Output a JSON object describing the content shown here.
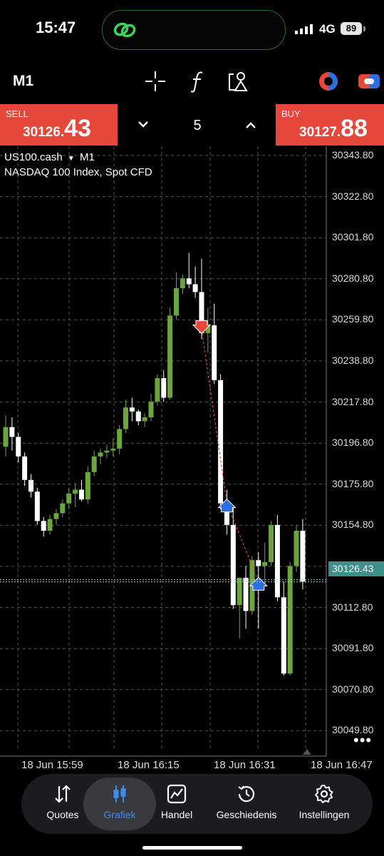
{
  "status_bar": {
    "time": "15:47",
    "network": "4G",
    "battery": "89"
  },
  "toolbar": {
    "timeframe": "M1"
  },
  "trade": {
    "sell_label": "SELL",
    "sell_price_main": "30126.",
    "sell_price_big": "43",
    "buy_label": "BUY",
    "buy_price_main": "30127.",
    "buy_price_big": "88",
    "lot": "5"
  },
  "chart": {
    "symbol": "US100.cash",
    "timeframe": "M1",
    "description": "NASDAQ 100 Index, Spot CFD",
    "price_labels": [
      "30343.80",
      "30322.80",
      "30301.80",
      "30280.80",
      "30259.80",
      "30238.80",
      "30217.80",
      "30196.80",
      "30175.80",
      "30154.80",
      "30133.80",
      "30112.80",
      "30091.80",
      "30070.80",
      "30049.80"
    ],
    "current_price": "30126.43",
    "time_labels": [
      "18 Jun 15:59",
      "18 Jun 16:15",
      "18 Jun 16:31",
      "18 Jun 16:47"
    ],
    "colors": {
      "up": "#6aa63a",
      "down": "#ffffff",
      "grid": "#555555",
      "sell": "#e5473b"
    }
  },
  "chart_data": {
    "type": "candlestick",
    "ylim": [
      30040,
      30350
    ],
    "candles": [
      {
        "o": 30195,
        "h": 30211,
        "l": 30190,
        "c": 30205
      },
      {
        "o": 30205,
        "h": 30210,
        "l": 30193,
        "c": 30200
      },
      {
        "o": 30200,
        "h": 30202,
        "l": 30187,
        "c": 30190
      },
      {
        "o": 30190,
        "h": 30192,
        "l": 30175,
        "c": 30178
      },
      {
        "o": 30178,
        "h": 30181,
        "l": 30169,
        "c": 30172
      },
      {
        "o": 30172,
        "h": 30174,
        "l": 30155,
        "c": 30157
      },
      {
        "o": 30157,
        "h": 30159,
        "l": 30149,
        "c": 30152
      },
      {
        "o": 30152,
        "h": 30160,
        "l": 30150,
        "c": 30158
      },
      {
        "o": 30158,
        "h": 30163,
        "l": 30155,
        "c": 30161
      },
      {
        "o": 30161,
        "h": 30168,
        "l": 30159,
        "c": 30166
      },
      {
        "o": 30166,
        "h": 30174,
        "l": 30163,
        "c": 30171
      },
      {
        "o": 30171,
        "h": 30176,
        "l": 30164,
        "c": 30173
      },
      {
        "o": 30173,
        "h": 30178,
        "l": 30167,
        "c": 30168
      },
      {
        "o": 30168,
        "h": 30185,
        "l": 30166,
        "c": 30182
      },
      {
        "o": 30182,
        "h": 30193,
        "l": 30180,
        "c": 30190
      },
      {
        "o": 30190,
        "h": 30194,
        "l": 30186,
        "c": 30192
      },
      {
        "o": 30192,
        "h": 30196,
        "l": 30189,
        "c": 30193
      },
      {
        "o": 30193,
        "h": 30199,
        "l": 30190,
        "c": 30194
      },
      {
        "o": 30194,
        "h": 30206,
        "l": 30191,
        "c": 30204
      },
      {
        "o": 30204,
        "h": 30219,
        "l": 30202,
        "c": 30215
      },
      {
        "o": 30215,
        "h": 30220,
        "l": 30208,
        "c": 30213
      },
      {
        "o": 30213,
        "h": 30214,
        "l": 30206,
        "c": 30208
      },
      {
        "o": 30208,
        "h": 30212,
        "l": 30205,
        "c": 30210
      },
      {
        "o": 30210,
        "h": 30222,
        "l": 30208,
        "c": 30218
      },
      {
        "o": 30218,
        "h": 30232,
        "l": 30216,
        "c": 30230
      },
      {
        "o": 30230,
        "h": 30234,
        "l": 30218,
        "c": 30220
      },
      {
        "o": 30220,
        "h": 30266,
        "l": 30219,
        "c": 30262
      },
      {
        "o": 30262,
        "h": 30284,
        "l": 30260,
        "c": 30276
      },
      {
        "o": 30276,
        "h": 30283,
        "l": 30273,
        "c": 30281
      },
      {
        "o": 30281,
        "h": 30294,
        "l": 30276,
        "c": 30278
      },
      {
        "o": 30278,
        "h": 30287,
        "l": 30271,
        "c": 30274
      },
      {
        "o": 30274,
        "h": 30291,
        "l": 30250,
        "c": 30253
      },
      {
        "o": 30253,
        "h": 30266,
        "l": 30243,
        "c": 30257
      },
      {
        "o": 30257,
        "h": 30268,
        "l": 30227,
        "c": 30229
      },
      {
        "o": 30229,
        "h": 30232,
        "l": 30163,
        "c": 30166
      },
      {
        "o": 30166,
        "h": 30173,
        "l": 30150,
        "c": 30155
      },
      {
        "o": 30155,
        "h": 30165,
        "l": 30112,
        "c": 30114
      },
      {
        "o": 30114,
        "h": 30128,
        "l": 30097,
        "c": 30128
      },
      {
        "o": 30128,
        "h": 30134,
        "l": 30102,
        "c": 30111
      },
      {
        "o": 30111,
        "h": 30139,
        "l": 30109,
        "c": 30137
      },
      {
        "o": 30137,
        "h": 30141,
        "l": 30102,
        "c": 30134
      },
      {
        "o": 30134,
        "h": 30146,
        "l": 30125,
        "c": 30136
      },
      {
        "o": 30136,
        "h": 30157,
        "l": 30134,
        "c": 30155
      },
      {
        "o": 30155,
        "h": 30160,
        "l": 30116,
        "c": 30118
      },
      {
        "o": 30118,
        "h": 30126,
        "l": 30078,
        "c": 30079
      },
      {
        "o": 30079,
        "h": 30136,
        "l": 30078,
        "c": 30134
      },
      {
        "o": 30134,
        "h": 30155,
        "l": 30131,
        "c": 30152
      },
      {
        "o": 30152,
        "h": 30158,
        "l": 30122,
        "c": 30126
      }
    ],
    "trades": [
      {
        "type": "sell",
        "price": 30255,
        "index": 31
      },
      {
        "type": "buy",
        "price": 30166,
        "index": 35
      },
      {
        "type": "buy",
        "price": 30126,
        "index": 40
      }
    ],
    "current_price": 30126.43
  },
  "nav": {
    "items": [
      {
        "label": "Quotes",
        "icon": "quotes-icon"
      },
      {
        "label": "Grafiek",
        "icon": "chart-icon"
      },
      {
        "label": "Handel",
        "icon": "trade-icon"
      },
      {
        "label": "Geschiedenis",
        "icon": "history-icon"
      },
      {
        "label": "Instellingen",
        "icon": "settings-icon"
      }
    ],
    "active": "Grafiek"
  }
}
